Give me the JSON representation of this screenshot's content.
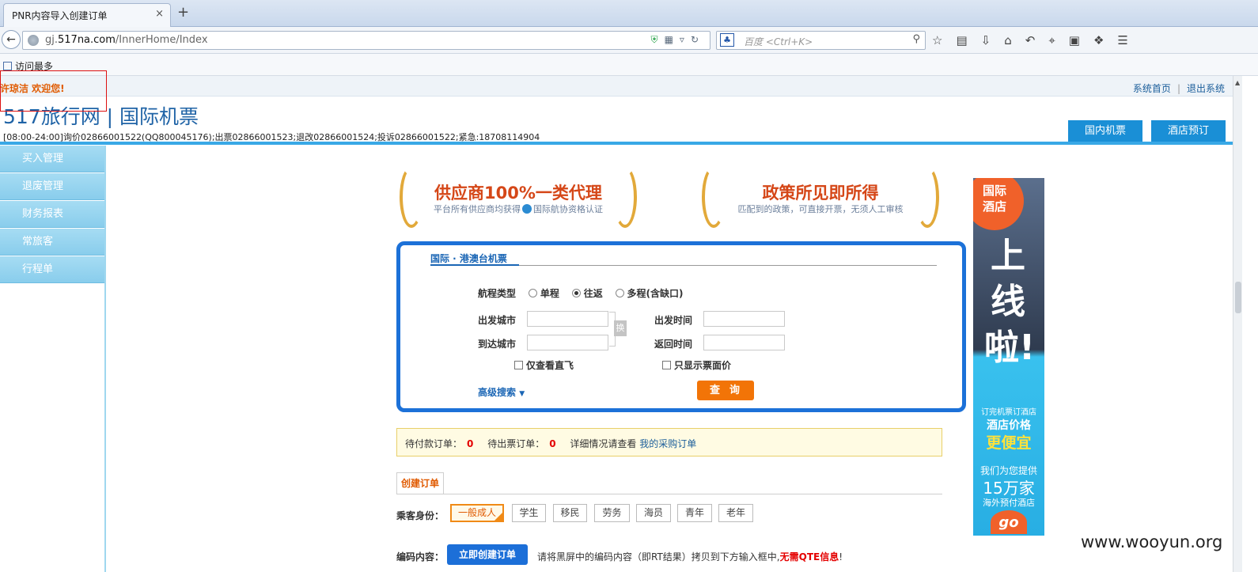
{
  "browser": {
    "tab_title": "PNR内容导入创建订单",
    "tab_close": "×",
    "new_tab": "+",
    "url_prefix": "gj.",
    "url_host": "517na.com",
    "url_path": "/InnerHome/Index",
    "search_placeholder": "百度 <Ctrl+K>",
    "bookmark": "访问最多"
  },
  "topbar": {
    "welcome": "许琼洁  欢迎您!",
    "home_link": "系统首页",
    "logout_link": "退出系统"
  },
  "header": {
    "title": "517旅行网 | 国际机票",
    "hotline": "[08:00-24:00]询价02866001522(QQ800045176);出票02866001523;退改02866001524;投诉02866001522;紧急:18708114904",
    "tabs": [
      "国内机票",
      "酒店预订"
    ]
  },
  "sidebar": {
    "items": [
      "买入管理",
      "退废管理",
      "财务报表",
      "常旅客",
      "行程单"
    ]
  },
  "promos": [
    {
      "title": "供应商100%一类代理",
      "sub_a": "平台所有供应商均获得",
      "sub_b": "国际航协资格认证"
    },
    {
      "title": "政策所见即所得",
      "sub_a": "匹配到的政策，可直接开票，无须人工审核",
      "sub_b": ""
    }
  ],
  "search": {
    "tab": "国际 · 港澳台机票",
    "trip_type_label": "航程类型",
    "trip_options": [
      {
        "label": "单程",
        "selected": false
      },
      {
        "label": "往返",
        "selected": true
      },
      {
        "label": "多程(含缺口)",
        "selected": false
      }
    ],
    "depart_city_label": "出发城市",
    "arrive_city_label": "到达城市",
    "depart_time_label": "出发时间",
    "return_time_label": "返回时间",
    "swap_label": "换",
    "direct_only": "仅查看直飞",
    "show_face_price": "只显示票面价",
    "advanced": "高级搜索",
    "advanced_arrow": "▼",
    "query_button": "查询"
  },
  "status": {
    "pending_pay_label": "待付款订单：",
    "pending_pay_count": "0",
    "pending_ticket_label": "待出票订单：",
    "pending_ticket_count": "0",
    "detail_text": "详细情况请查看",
    "detail_link": "我的采购订单"
  },
  "create_order": {
    "tab": "创建订单",
    "passenger_label": "乘客身份：",
    "passenger_types": [
      {
        "label": "一般成人",
        "selected": true
      },
      {
        "label": "学生",
        "selected": false
      },
      {
        "label": "移民",
        "selected": false
      },
      {
        "label": "劳务",
        "selected": false
      },
      {
        "label": "海员",
        "selected": false
      },
      {
        "label": "青年",
        "selected": false
      },
      {
        "label": "老年",
        "selected": false
      }
    ],
    "code_label": "编码内容：",
    "create_button": "立即创建订单",
    "hint": "请将黑屏中的编码内容（即RT结果）拷贝到下方输入框中,",
    "hint_red": "无需QTE信息",
    "hint_end": "!"
  },
  "ad": {
    "circle": "国际\n酒店",
    "big": "上线啦!",
    "line1": "订完机票订酒店",
    "line2": "酒店价格",
    "line3": "更便宜",
    "line4": "我们为您提供",
    "line5": "15万家",
    "line6": "海外预付酒店",
    "go": "go"
  },
  "watermark": "www.wooyun.org",
  "colors": {
    "accent_blue": "#1c71d8",
    "sidebar_blue": "#89cdec",
    "orange": "#f27407",
    "title_blue": "#1f63a6"
  }
}
